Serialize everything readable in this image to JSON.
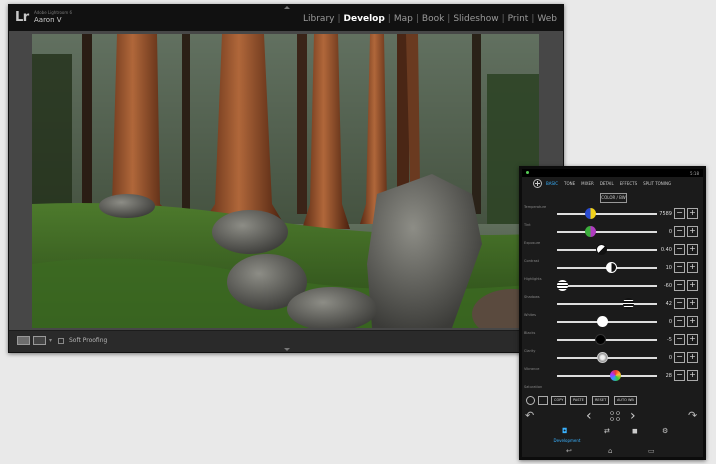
{
  "lightroom": {
    "product_line": "Adobe Lightroom 6",
    "user_name": "Aaron V",
    "logo": "Lr",
    "modules": [
      {
        "label": "Library",
        "active": false
      },
      {
        "label": "Develop",
        "active": true
      },
      {
        "label": "Map",
        "active": false
      },
      {
        "label": "Book",
        "active": false
      },
      {
        "label": "Slideshow",
        "active": false
      },
      {
        "label": "Print",
        "active": false
      },
      {
        "label": "Web",
        "active": false
      }
    ],
    "toolbar": {
      "soft_proofing_label": "Soft Proofing"
    }
  },
  "tablet": {
    "status_time": "5:18",
    "tabs": [
      "BASIC",
      "TONE",
      "MIXER",
      "DETAIL",
      "EFFECTS",
      "SPLIT TONING"
    ],
    "active_tab": "BASIC",
    "color_bw_label": "COLOR / BW",
    "sliders": [
      {
        "label": "Temperature",
        "value": "7589",
        "position": 0.33,
        "knob": "temperature"
      },
      {
        "label": "Tint",
        "value": "0",
        "position": 0.33,
        "knob": "tint"
      },
      {
        "label": "Exposure",
        "value": "0.40",
        "position": 0.44,
        "knob": "exposure"
      },
      {
        "label": "Contrast",
        "value": "10",
        "position": 0.54,
        "knob": "contrast"
      },
      {
        "label": "Highlights",
        "value": "-60",
        "position": 0.05,
        "knob": "highlights"
      },
      {
        "label": "Shadows",
        "value": "42",
        "position": 0.71,
        "knob": "shadows"
      },
      {
        "label": "Whites",
        "value": "0",
        "position": 0.45,
        "knob": "whites"
      },
      {
        "label": "Blacks",
        "value": "-5",
        "position": 0.43,
        "knob": "blacks"
      },
      {
        "label": "Clarity",
        "value": "0",
        "position": 0.45,
        "knob": "clarity"
      },
      {
        "label": "Vibrance",
        "value": "28",
        "position": 0.58,
        "knob": "vibrance"
      }
    ],
    "last_label": "Saturation",
    "tool_buttons": [
      "COPY",
      "PASTE",
      "RESET",
      "AUTO WB"
    ],
    "bottom_nav_label": "Development",
    "colors": {
      "accent": "#3ab2ff"
    }
  }
}
